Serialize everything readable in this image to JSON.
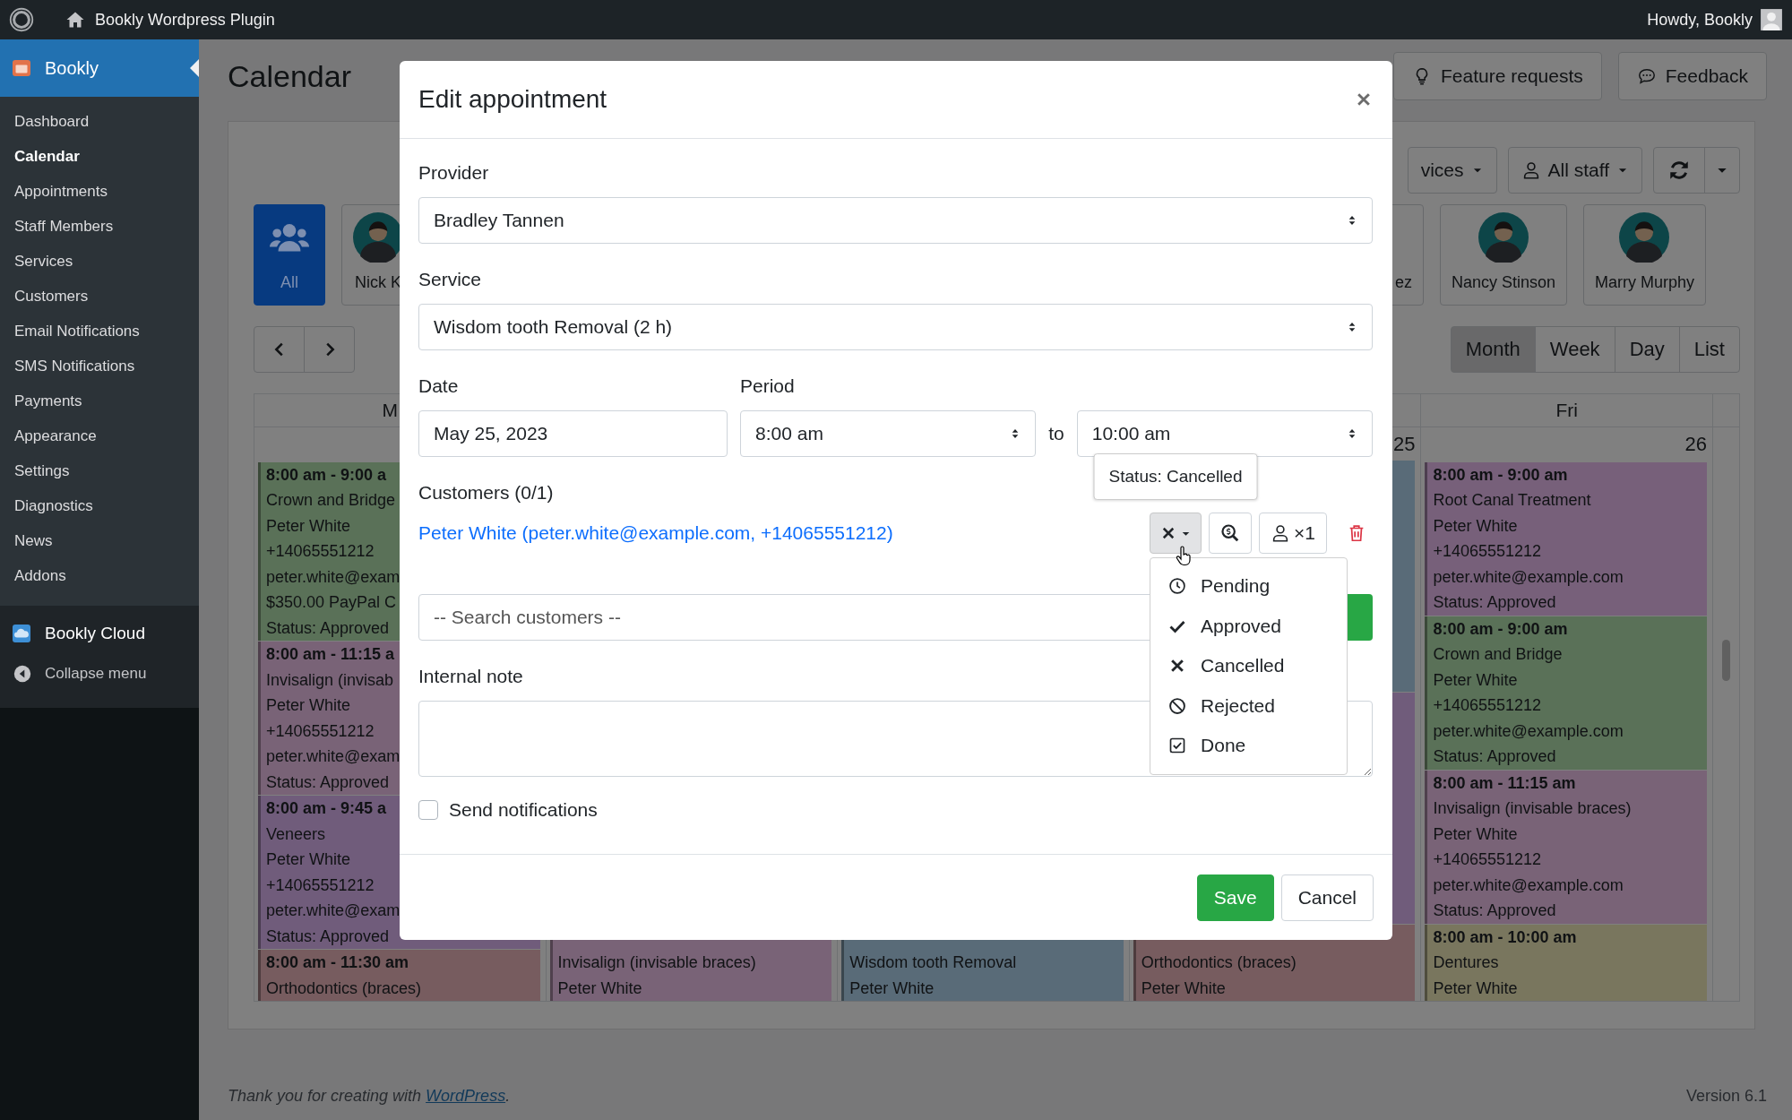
{
  "admin_bar": {
    "site_name": "Bookly Wordpress Plugin",
    "greeting": "Howdy, Bookly"
  },
  "sidebar": {
    "plugin": {
      "label": "Bookly",
      "selected": true
    },
    "submenu": [
      {
        "label": "Dashboard",
        "selected": false
      },
      {
        "label": "Calendar",
        "selected": true
      },
      {
        "label": "Appointments",
        "selected": false
      },
      {
        "label": "Staff Members",
        "selected": false
      },
      {
        "label": "Services",
        "selected": false
      },
      {
        "label": "Customers",
        "selected": false
      },
      {
        "label": "Email Notifications",
        "selected": false
      },
      {
        "label": "SMS Notifications",
        "selected": false
      },
      {
        "label": "Payments",
        "selected": false
      },
      {
        "label": "Appearance",
        "selected": false
      },
      {
        "label": "Settings",
        "selected": false
      },
      {
        "label": "Diagnostics",
        "selected": false
      },
      {
        "label": "News",
        "selected": false
      },
      {
        "label": "Addons",
        "selected": false
      }
    ],
    "cloud": "Bookly Cloud",
    "collapse": "Collapse menu"
  },
  "page": {
    "title": "Calendar",
    "buttons": [
      {
        "label": "Feature requests",
        "kind": "idea"
      },
      {
        "label": "Feedback",
        "kind": "chat"
      }
    ]
  },
  "calendar_panel": {
    "filters": [
      {
        "label": "vices",
        "kind": "plain"
      },
      {
        "label": "All staff",
        "kind": "staff"
      }
    ],
    "staff": [
      {
        "name": "All",
        "kind": "all",
        "selected": true
      },
      {
        "name": "Nick K",
        "kind": "person",
        "selected": false
      },
      {
        "name": "ez",
        "kind": "cut",
        "selected": false
      },
      {
        "name": "Nancy Stinson",
        "kind": "person",
        "selected": false
      },
      {
        "name": "Marry Murphy",
        "kind": "person",
        "selected": false
      }
    ],
    "views": [
      {
        "label": "Month",
        "selected": true
      },
      {
        "label": "Week",
        "selected": false
      },
      {
        "label": "Day",
        "selected": false
      },
      {
        "label": "List",
        "selected": false
      }
    ],
    "columns": [
      {
        "header": "M",
        "events": [
          {
            "color": "#5a7158",
            "time": "8:00 am - 9:00 a",
            "lines": [
              "Crown and Bridge",
              "Peter White",
              "+14065551212",
              "peter.white@exam",
              "$350.00 PayPal C",
              "Status: Approved"
            ]
          },
          {
            "color": "#796377",
            "time": "8:00 am - 11:15 a",
            "lines": [
              "Invisalign (invisab",
              "Peter White",
              "+14065551212",
              "peter.white@exam",
              "Status: Approved"
            ]
          },
          {
            "color": "#705c7b",
            "time": "8:00 am - 9:45 a",
            "lines": [
              "Veneers",
              "Peter White",
              "+14065551212",
              "peter.white@exam",
              "Status: Approved"
            ]
          },
          {
            "color": "#775c5f",
            "time": "8:00 am - 11:30 am",
            "lines": [
              "Orthodontics (braces)"
            ]
          }
        ]
      },
      {
        "events": [
          {
            "color": "#796377",
            "lines": [
              "Invisalign (invisable braces)",
              "Peter White"
            ]
          }
        ]
      },
      {
        "events": [
          {
            "color": "#596b78",
            "lines": [
              "Wisdom tooth Removal",
              "Peter White"
            ]
          }
        ]
      },
      {
        "date": "25",
        "events": [
          {
            "color": "#596b78"
          },
          {
            "color": "#705c7b"
          },
          {
            "color": "#775c5f",
            "lines": [
              "Orthodontics (braces)",
              "Peter White"
            ]
          }
        ]
      },
      {
        "header": "Fri",
        "date": "26",
        "events": [
          {
            "color": "#77607a",
            "time": "8:00 am - 9:00 am",
            "lines": [
              "Root Canal Treatment",
              "Peter White",
              "+14065551212",
              "peter.white@example.com",
              "Status: Approved"
            ]
          },
          {
            "color": "#5a7158",
            "time": "8:00 am - 9:00 am",
            "lines": [
              "Crown and Bridge",
              "Peter White",
              "+14065551212",
              "peter.white@example.com",
              "Status: Approved"
            ]
          },
          {
            "color": "#796377",
            "time": "8:00 am - 11:15 am",
            "lines": [
              "Invisalign (invisable braces)",
              "Peter White",
              "+14065551212",
              "peter.white@example.com",
              "Status: Approved"
            ]
          },
          {
            "color": "#79765e",
            "time": "8:00 am - 10:00 am",
            "lines": [
              "Dentures",
              "Peter White"
            ]
          }
        ]
      }
    ]
  },
  "modal": {
    "title": "Edit appointment",
    "provider": {
      "label": "Provider",
      "value": "Bradley Tannen"
    },
    "service": {
      "label": "Service",
      "value": "Wisdom tooth Removal (2 h)"
    },
    "date": {
      "label": "Date",
      "value": "May 25, 2023"
    },
    "period": {
      "label": "Period",
      "from": "8:00 am",
      "separator": "to",
      "to": "10:00 am"
    },
    "customers": {
      "label": "Customers (0/1)",
      "items": [
        {
          "name": "Peter White (peter.white@example.com, +14065551212)",
          "kind": "cancelled",
          "tooltip": "Status: Cancelled",
          "count": "×1"
        }
      ]
    },
    "status_menu": [
      {
        "label": "Pending",
        "kind": "pending"
      },
      {
        "label": "Approved",
        "kind": "approved"
      },
      {
        "label": "Cancelled",
        "kind": "cancelled"
      },
      {
        "label": "Rejected",
        "kind": "rejected"
      },
      {
        "label": "Done",
        "kind": "done"
      }
    ],
    "search": {
      "placeholder": "-- Search customers --"
    },
    "note": {
      "label": "Internal note"
    },
    "send_notifications": {
      "label": "Send notifications",
      "checked": false
    },
    "buttons": {
      "save": "Save",
      "cancel": "Cancel"
    }
  },
  "footer": {
    "text": "Thank you for creating with ",
    "link": "WordPress",
    "end": ".",
    "version": "Version 6.1"
  }
}
